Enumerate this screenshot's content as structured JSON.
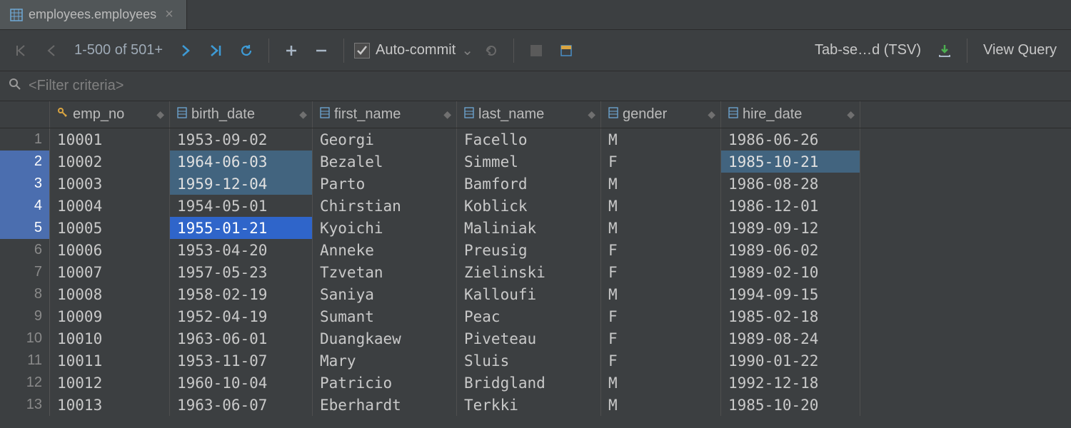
{
  "tab": {
    "label": "employees.employees"
  },
  "toolbar": {
    "range": "1-500 of 501+",
    "auto_commit": "Auto-commit",
    "export_format": "Tab-se…d (TSV)",
    "view_query": "View Query"
  },
  "filter": {
    "placeholder": "<Filter criteria>"
  },
  "columns": [
    {
      "name": "emp_no",
      "pk": true
    },
    {
      "name": "birth_date",
      "pk": false
    },
    {
      "name": "first_name",
      "pk": false
    },
    {
      "name": "last_name",
      "pk": false
    },
    {
      "name": "gender",
      "pk": false
    },
    {
      "name": "hire_date",
      "pk": false
    }
  ],
  "rows": [
    {
      "n": 1,
      "emp_no": "10001",
      "birth_date": "1953-09-02",
      "first_name": "Georgi",
      "last_name": "Facello",
      "gender": "M",
      "hire_date": "1986-06-26"
    },
    {
      "n": 2,
      "emp_no": "10002",
      "birth_date": "1964-06-03",
      "first_name": "Bezalel",
      "last_name": "Simmel",
      "gender": "F",
      "hire_date": "1985-10-21"
    },
    {
      "n": 3,
      "emp_no": "10003",
      "birth_date": "1959-12-04",
      "first_name": "Parto",
      "last_name": "Bamford",
      "gender": "M",
      "hire_date": "1986-08-28"
    },
    {
      "n": 4,
      "emp_no": "10004",
      "birth_date": "1954-05-01",
      "first_name": "Chirstian",
      "last_name": "Koblick",
      "gender": "M",
      "hire_date": "1986-12-01"
    },
    {
      "n": 5,
      "emp_no": "10005",
      "birth_date": "1955-01-21",
      "first_name": "Kyoichi",
      "last_name": "Maliniak",
      "gender": "M",
      "hire_date": "1989-09-12"
    },
    {
      "n": 6,
      "emp_no": "10006",
      "birth_date": "1953-04-20",
      "first_name": "Anneke",
      "last_name": "Preusig",
      "gender": "F",
      "hire_date": "1989-06-02"
    },
    {
      "n": 7,
      "emp_no": "10007",
      "birth_date": "1957-05-23",
      "first_name": "Tzvetan",
      "last_name": "Zielinski",
      "gender": "F",
      "hire_date": "1989-02-10"
    },
    {
      "n": 8,
      "emp_no": "10008",
      "birth_date": "1958-02-19",
      "first_name": "Saniya",
      "last_name": "Kalloufi",
      "gender": "M",
      "hire_date": "1994-09-15"
    },
    {
      "n": 9,
      "emp_no": "10009",
      "birth_date": "1952-04-19",
      "first_name": "Sumant",
      "last_name": "Peac",
      "gender": "F",
      "hire_date": "1985-02-18"
    },
    {
      "n": 10,
      "emp_no": "10010",
      "birth_date": "1963-06-01",
      "first_name": "Duangkaew",
      "last_name": "Piveteau",
      "gender": "F",
      "hire_date": "1989-08-24"
    },
    {
      "n": 11,
      "emp_no": "10011",
      "birth_date": "1953-11-07",
      "first_name": "Mary",
      "last_name": "Sluis",
      "gender": "F",
      "hire_date": "1990-01-22"
    },
    {
      "n": 12,
      "emp_no": "10012",
      "birth_date": "1960-10-04",
      "first_name": "Patricio",
      "last_name": "Bridgland",
      "gender": "M",
      "hire_date": "1992-12-18"
    },
    {
      "n": 13,
      "emp_no": "10013",
      "birth_date": "1963-06-07",
      "first_name": "Eberhardt",
      "last_name": "Terkki",
      "gender": "M",
      "hire_date": "1985-10-20"
    }
  ],
  "selection": {
    "selected_rows": [
      2,
      3,
      4,
      5
    ],
    "light_cells": [
      {
        "row": 2,
        "col": "birth_date"
      },
      {
        "row": 2,
        "col": "hire_date"
      },
      {
        "row": 3,
        "col": "birth_date"
      }
    ],
    "dark_cells": [
      {
        "row": 5,
        "col": "birth_date"
      }
    ]
  }
}
